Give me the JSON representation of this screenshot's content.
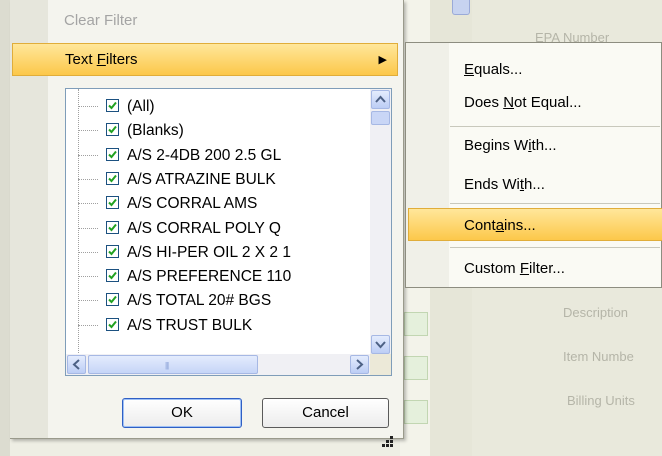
{
  "background": {
    "labels": [
      "EPA Number",
      "Description",
      "Item Numbe",
      "Billing Units"
    ]
  },
  "filter_panel": {
    "clear_filter_label": "Clear Filter",
    "text_filters": {
      "pre": "Text ",
      "key": "F",
      "post": "ilters"
    },
    "items": [
      {
        "label": "(All)",
        "checked": true
      },
      {
        "label": "(Blanks)",
        "checked": true
      },
      {
        "label": "A/S 2-4DB 200   2.5 GL",
        "checked": true
      },
      {
        "label": "A/S ATRAZINE BULK",
        "checked": true
      },
      {
        "label": "A/S CORRAL AMS",
        "checked": true
      },
      {
        "label": "A/S CORRAL POLY  Q",
        "checked": true
      },
      {
        "label": "A/S HI-PER OIL 2 X 2 1",
        "checked": true
      },
      {
        "label": "A/S PREFERENCE 110",
        "checked": true
      },
      {
        "label": "A/S TOTAL  20# BGS",
        "checked": true
      },
      {
        "label": "A/S TRUST BULK",
        "checked": true
      }
    ],
    "ok_label": "OK",
    "cancel_label": "Cancel"
  },
  "submenu": {
    "equals": {
      "pre": "",
      "key": "E",
      "post": "quals..."
    },
    "does_not_equal": {
      "pre": "Does ",
      "key": "N",
      "post": "ot Equal..."
    },
    "begins_with": {
      "pre": "Begins W",
      "key": "i",
      "post": "th..."
    },
    "ends_with": {
      "pre": "Ends Wi",
      "key": "t",
      "post": "h..."
    },
    "contains": {
      "pre": "Cont",
      "key": "a",
      "post": "ins..."
    },
    "custom_filter": {
      "pre": "Custom ",
      "key": "F",
      "post": "ilter..."
    }
  },
  "colors": {
    "highlight": "#fcc84a",
    "checkbox_check": "#21a121",
    "scrollbar": "#bccdf5"
  }
}
